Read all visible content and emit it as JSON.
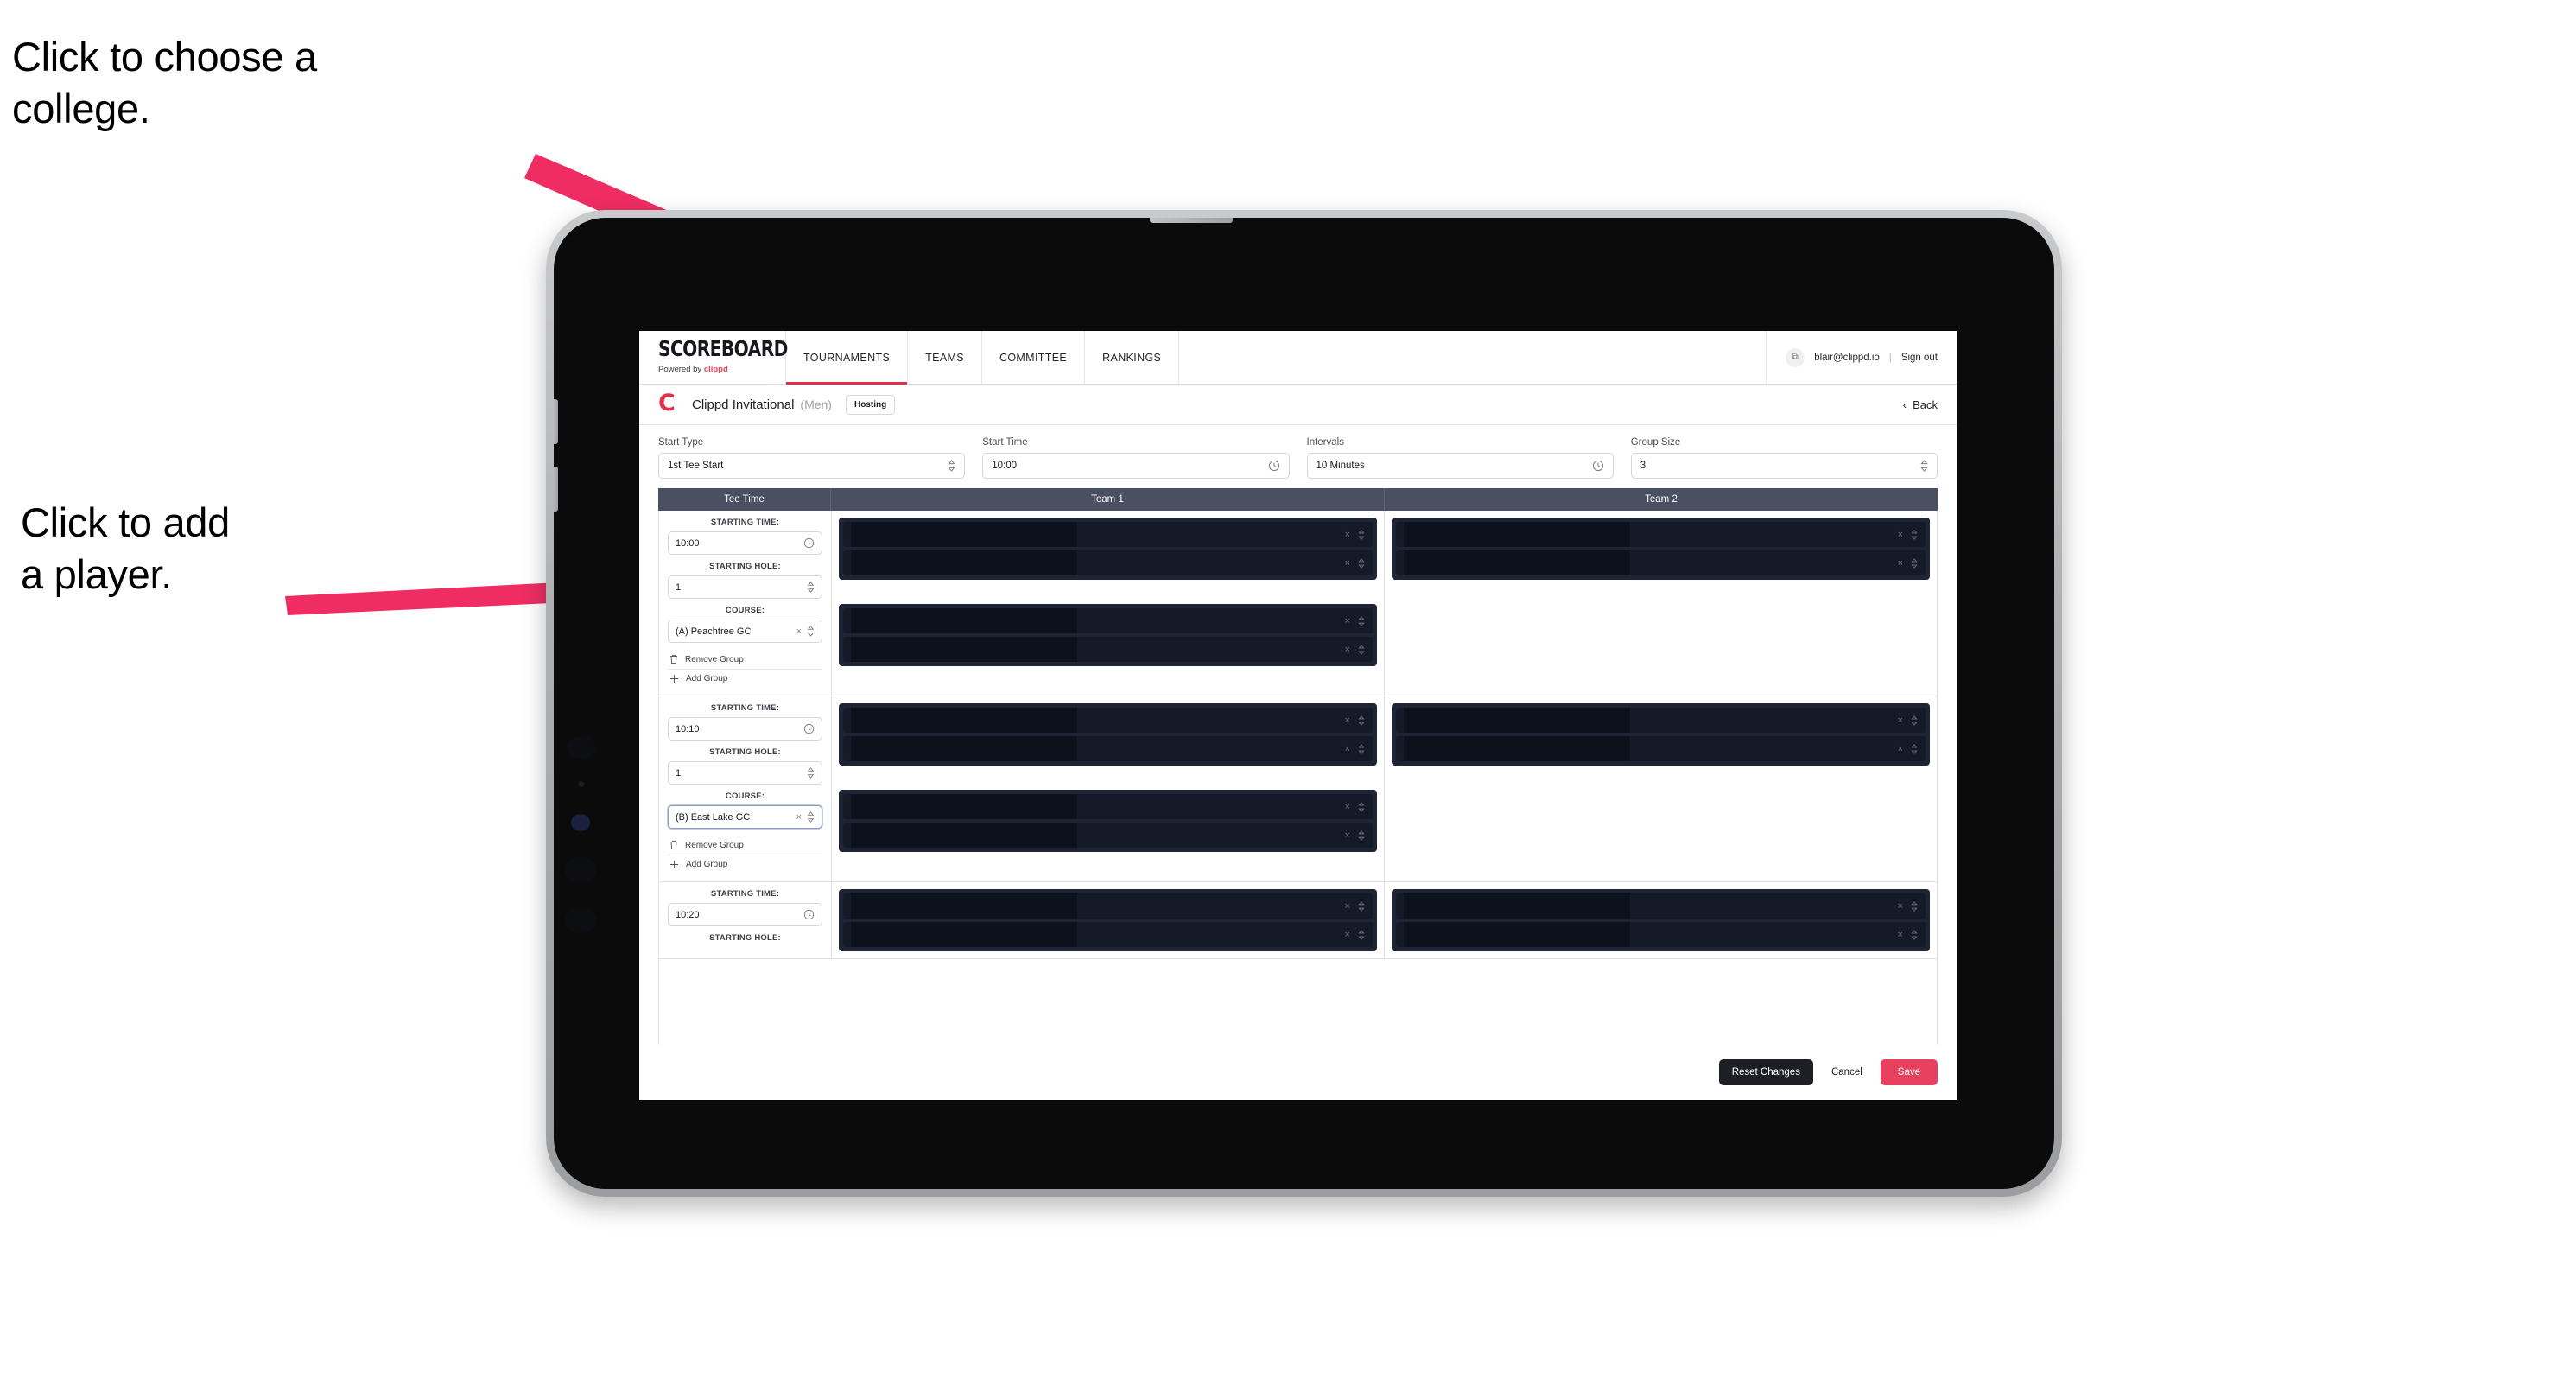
{
  "annotations": [
    {
      "id": "college",
      "text": "Click to choose a\ncollege."
    },
    {
      "id": "player",
      "text": "Click to add\na player."
    }
  ],
  "colors": {
    "accent_pink": "#e8405f",
    "brand_red": "#e0304c",
    "table_header": "#4a4f62",
    "redacted_panel": "#1e2433",
    "redacted_row": "#141a27",
    "arrow": "#ef2d63"
  },
  "nav": {
    "logo_word": "SCOREBOARD",
    "logo_sub_prefix": "Powered by ",
    "logo_sub_brand": "clippd",
    "tabs": [
      {
        "label": "TOURNAMENTS",
        "active": true
      },
      {
        "label": "TEAMS",
        "active": false
      },
      {
        "label": "COMMITTEE",
        "active": false
      },
      {
        "label": "RANKINGS",
        "active": false
      }
    ],
    "user_email": "blair@clippd.io",
    "separator": "|",
    "sign_out": "Sign out",
    "avatar_glyph": "⧉"
  },
  "tournament": {
    "logo_letter": "C",
    "name": "Clippd Invitational",
    "gender": "(Men)",
    "badge": "Hosting",
    "back_label": "Back",
    "back_chevron": "‹"
  },
  "controls": [
    {
      "label": "Start Type",
      "value": "1st Tee Start",
      "icon": "stepper-icon"
    },
    {
      "label": "Start Time",
      "value": "10:00",
      "icon": "clock-icon"
    },
    {
      "label": "Intervals",
      "value": "10 Minutes",
      "icon": "clock-icon"
    },
    {
      "label": "Group Size",
      "value": "3",
      "icon": "stepper-icon"
    }
  ],
  "table": {
    "columns": [
      "Tee Time",
      "Team 1",
      "Team 2"
    ],
    "field_labels": {
      "starting_time": "STARTING TIME:",
      "starting_hole": "STARTING HOLE:",
      "course": "COURSE:"
    },
    "group_actions": {
      "remove": "Remove Group",
      "add": "Add Group",
      "remove_icon": "trash-icon",
      "add_icon": "plus-icon"
    },
    "row_icons": {
      "clear": "×",
      "stepper": "⇅"
    },
    "rows": [
      {
        "starting_time": "10:00",
        "starting_hole": "1",
        "course": "(A) Peachtree GC",
        "course_focused": false,
        "team1_groups": [
          {
            "players": 2
          },
          {
            "players": 2
          }
        ],
        "team2_groups": [
          {
            "players": 2
          }
        ]
      },
      {
        "starting_time": "10:10",
        "starting_hole": "1",
        "course": "(B) East Lake GC",
        "course_focused": true,
        "team1_groups": [
          {
            "players": 2
          },
          {
            "players": 2
          }
        ],
        "team2_groups": [
          {
            "players": 2
          }
        ]
      },
      {
        "starting_time": "10:20",
        "starting_hole": "",
        "course": "",
        "course_focused": false,
        "team1_groups": [
          {
            "players": 2
          }
        ],
        "team2_groups": [
          {
            "players": 2
          }
        ]
      }
    ]
  },
  "footer": {
    "reset": "Reset Changes",
    "cancel": "Cancel",
    "save": "Save"
  }
}
